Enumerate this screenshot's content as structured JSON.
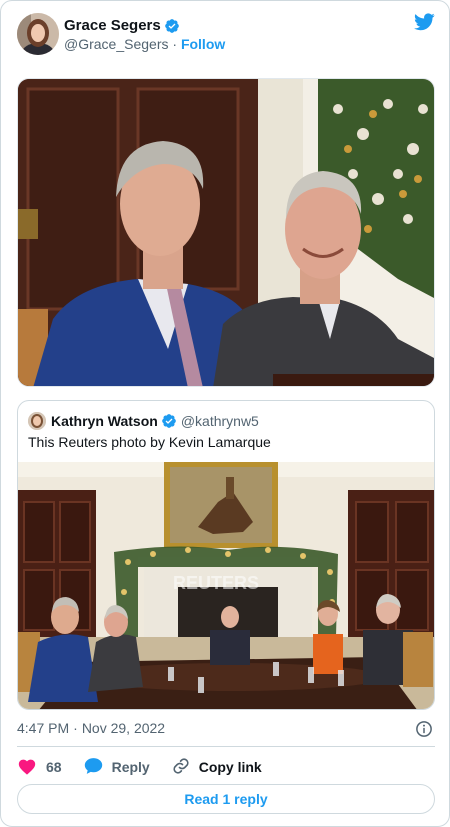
{
  "author": {
    "name": "Grace Segers",
    "handle": "@Grace_Segers",
    "separator": "·",
    "follow_label": "Follow"
  },
  "main_image": {
    "alt": "Kevin McCarthy and Chuck Schumer seated at a table"
  },
  "quoted_tweet": {
    "name": "Kathryn Watson",
    "handle": "@kathrynw5",
    "text": "This Reuters photo by Kevin Lamarque",
    "watermark": "REUTERS"
  },
  "meta": {
    "time": "4:47 PM",
    "separator": "·",
    "date": "Nov 29, 2022"
  },
  "actions": {
    "like_count": "68",
    "reply_label": "Reply",
    "copy_link_label": "Copy link"
  },
  "read_replies_label": "Read 1 reply",
  "colors": {
    "accent": "#1d9bf0",
    "like": "#f91880",
    "muted": "#536471",
    "border": "#cfd9de"
  },
  "icons": [
    "verified-badge-icon",
    "twitter-bird-icon",
    "info-icon",
    "heart-icon",
    "reply-bubble-icon",
    "link-icon"
  ]
}
